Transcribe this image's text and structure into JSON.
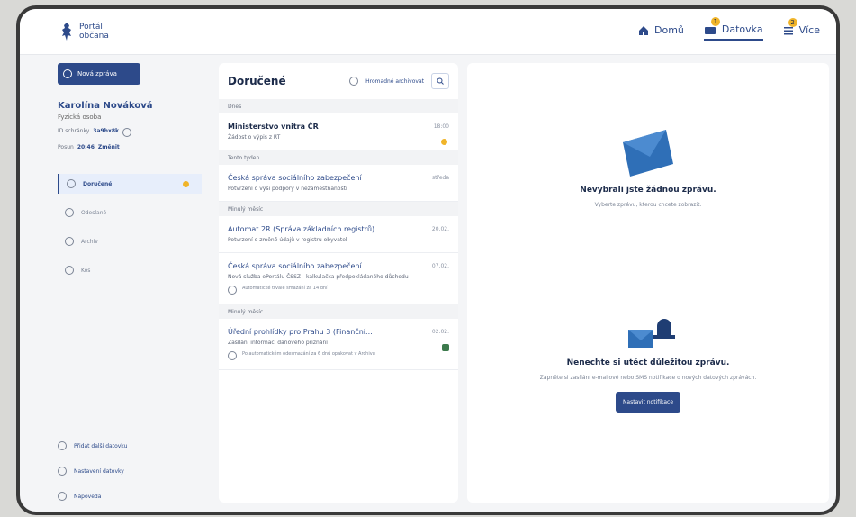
{
  "app": {
    "logo_line1": "Portál",
    "logo_line2": "občana"
  },
  "nav": {
    "home": "Domů",
    "datovka": "Datovka",
    "more": "Více",
    "datovka_badge": "1",
    "more_badge": "2"
  },
  "sidebar": {
    "new_message": "Nová zpráva",
    "user_name": "Karolína Nováková",
    "user_role": "Fyzická osoba",
    "id_label": "ID schránky",
    "id_value": "3a9hx8k",
    "login_label": "Posun",
    "login_value": "20:46",
    "login_action": "Změnit",
    "folders": [
      {
        "label": "Doručené",
        "active": true
      },
      {
        "label": "Odeslané",
        "active": false
      },
      {
        "label": "Archiv",
        "active": false
      },
      {
        "label": "Koš",
        "active": false
      }
    ],
    "help": [
      {
        "label": "Přidat další datovku"
      },
      {
        "label": "Nastavení datovky"
      },
      {
        "label": "Nápověda"
      }
    ]
  },
  "messages_panel": {
    "title": "Doručené",
    "show_archive": "Hromadné archivovat",
    "sections": [
      {
        "label": "Dnes",
        "items": [
          {
            "sender": "Ministerstvo vnitra ČR",
            "subject": "Žádost o výpis z RT",
            "time": "18:00",
            "unread": true,
            "marker": "dot"
          }
        ]
      },
      {
        "label": "Tento týden",
        "items": [
          {
            "sender": "Česká správa sociálního zabezpečení",
            "subject": "Potvrzení o výši podpory v nezaměstnanosti",
            "time": "středa",
            "unread": false,
            "marker": ""
          }
        ]
      },
      {
        "label": "Minulý měsíc",
        "items": [
          {
            "sender": "Automat 2R (Správa základních registrů)",
            "subject": "Potvrzení o změně údajů v registru obyvatel",
            "time": "20.02.",
            "unread": false,
            "marker": ""
          },
          {
            "sender": "Česká správa sociálního zabezpečení",
            "subject": "Nová služba ePortálu ČSSZ - kalkulačka předpokládaného důchodu",
            "time": "07.02.",
            "unread": false,
            "extra": "Automatické trvalé smazání za 14 dní",
            "marker": ""
          }
        ]
      },
      {
        "label": "Minulý měsíc",
        "items": [
          {
            "sender": "Úřední prohlídky pro Prahu 3 (Finanční...",
            "subject": "Zasílání informací daňového přiznání",
            "time": "02.02.",
            "unread": false,
            "extra": "Po automatickém odesmazání za 6 dnů opakovat v Archivu",
            "marker": "attach"
          }
        ]
      }
    ]
  },
  "detail_panel": {
    "empty_title": "Nevybrali jste žádnou zprávu.",
    "empty_subtitle": "Vyberte zprávu, kterou chcete zobrazit.",
    "notif_title": "Nenechte si utéct důležitou zprávu.",
    "notif_subtitle": "Zapněte si zasílání e-mailové nebo SMS notifikace o nových datových zprávách.",
    "notif_button": "Nastavit notifikace"
  },
  "colors": {
    "primary": "#2d4a8a",
    "accent": "#f0b429"
  }
}
